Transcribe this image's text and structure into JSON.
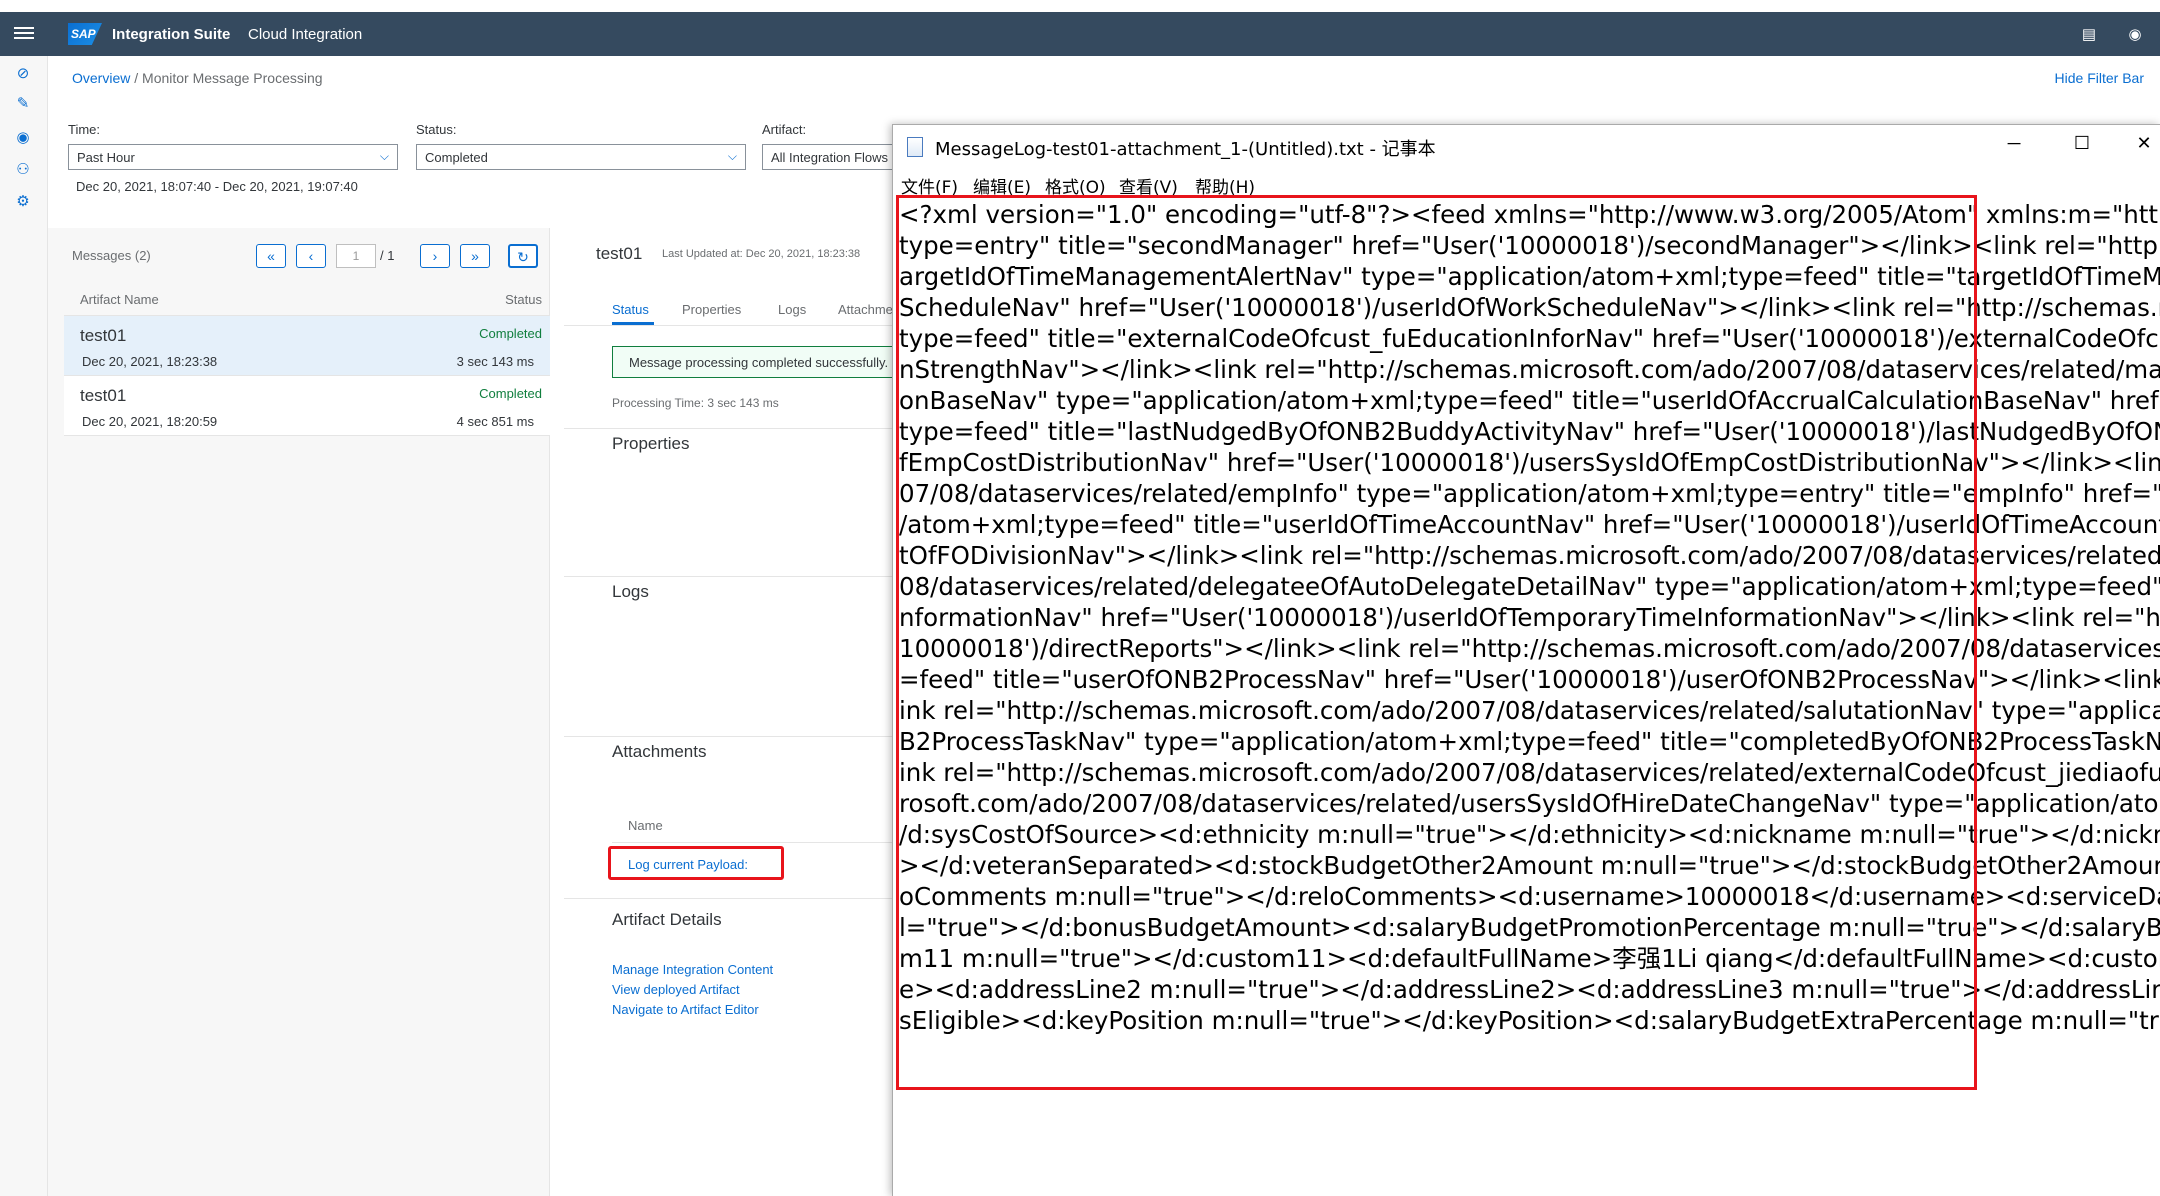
{
  "shell": {
    "logo": "SAP",
    "app_title": "Integration Suite",
    "subtitle": "Cloud Integration"
  },
  "breadcrumb": {
    "overview": "Overview",
    "separator": " / ",
    "current": "Monitor Message Processing"
  },
  "hide_filter_bar": "Hide Filter Bar",
  "filters": {
    "time_label": "Time:",
    "time_value": "Past Hour",
    "status_label": "Status:",
    "status_value": "Completed",
    "artifact_label": "Artifact:",
    "artifact_value": "All Integration Flows",
    "date_range": "Dec 20, 2021, 18:07:40 - Dec 20, 2021, 19:07:40"
  },
  "messages": {
    "count_label": "Messages (2)",
    "page_current": "1",
    "page_total": "/ 1",
    "col_artifact": "Artifact Name",
    "col_status": "Status",
    "rows": [
      {
        "name": "test01",
        "status": "Completed",
        "date": "Dec 20, 2021, 18:23:38",
        "duration": "3 sec 143 ms"
      },
      {
        "name": "test01",
        "status": "Completed",
        "date": "Dec 20, 2021, 18:20:59",
        "duration": "4 sec 851 ms"
      }
    ]
  },
  "detail": {
    "title": "test01",
    "last_updated": "Last Updated at: Dec 20, 2021, 18:23:38",
    "tabs": [
      "Status",
      "Properties",
      "Logs",
      "Attachments"
    ],
    "status_message": "Message processing completed successfully.",
    "processing_time": "Processing Time: 3 sec 143 ms",
    "sections": {
      "properties": "Properties",
      "logs": "Logs",
      "attachments": "Attachments",
      "artifact_details": "Artifact Details"
    },
    "attachments_col_name": "Name",
    "attachment_link": "Log current Payload:",
    "artifact_links": [
      "Manage Integration Content",
      "View deployed Artifact",
      "Navigate to Artifact Editor"
    ]
  },
  "notepad": {
    "title": "MessageLog-test01-attachment_1-(Untitled).txt - 记事本",
    "menu": [
      "文件(F)",
      "编辑(E)",
      "格式(O)",
      "查看(V)",
      "帮助(H)"
    ],
    "content": "<?xml version=\"1.0\" encoding=\"utf-8\"?><feed xmlns=\"http://www.w3.org/2005/Atom\" xmlns:m=\"http://sche\ntype=entry\" title=\"secondManager\" href=\"User('10000018')/secondManager\"></link><link rel=\"http://schema\nargetIdOfTimeManagementAlertNav\" type=\"application/atom+xml;type=feed\" title=\"targetIdOfTimeManager\nScheduleNav\" href=\"User('10000018')/userIdOfWorkScheduleNav\"></link><link rel=\"http://schemas.microso\ntype=feed\" title=\"externalCodeOfcust_fuEducationInforNav\" href=\"User('10000018')/externalCodeOfcust_fuEd\nnStrengthNav\"></link><link rel=\"http://schemas.microsoft.com/ado/2007/08/dataservices/related/manager\"\nonBaseNav\" type=\"application/atom+xml;type=feed\" title=\"userIdOfAccrualCalculationBaseNav\" href=\"User('\ntype=feed\" title=\"lastNudgedByOfONB2BuddyActivityNav\" href=\"User('10000018')/lastNudgedByOfONB2Bu\nfEmpCostDistributionNav\" href=\"User('10000018')/usersSysIdOfEmpCostDistributionNav\"></link><link rel=\"h\n07/08/dataservices/related/empInfo\" type=\"application/atom+xml;type=entry\" title=\"empInfo\" href=\"User('10\n/atom+xml;type=feed\" title=\"userIdOfTimeAccountNav\" href=\"User('10000018')/userIdOfTimeAccountNav\">\ntOfFODivisionNav\"></link><link rel=\"http://schemas.microsoft.com/ado/2007/08/dataservices/related/cust_s\n08/dataservices/related/delegateeOfAutoDelegateDetailNav\" type=\"application/atom+xml;type=feed\" title=\"\nnformationNav\" href=\"User('10000018')/userIdOfTemporaryTimeInformationNav\"></link><link rel=\"http://sc\n10000018')/directReports\"></link><link rel=\"http://schemas.microsoft.com/ado/2007/08/dataservices/relate\n=feed\" title=\"userOfONB2ProcessNav\" href=\"User('10000018')/userOfONB2ProcessNav\"></link><link rel=\"h\nink rel=\"http://schemas.microsoft.com/ado/2007/08/dataservices/related/salutationNav\" type=\"application/at\nB2ProcessTaskNav\" type=\"application/atom+xml;type=feed\" title=\"completedByOfONB2ProcessTaskNav\" hre\nink rel=\"http://schemas.microsoft.com/ado/2007/08/dataservices/related/externalCodeOfcust_jiediaofuNav\" ty\nrosoft.com/ado/2007/08/dataservices/related/usersSysIdOfHireDateChangeNav\" type=\"application/atom+xml\n/d:sysCostOfSource><d:ethnicity m:null=\"true\"></d:ethnicity><d:nickname m:null=\"true\"></d:nickname><d\n></d:veteranSeparated><d:stockBudgetOther2Amount m:null=\"true\"></d:stockBudgetOther2Amount><d:fi\noComments m:null=\"true\"></d:reloComments><d:username>10000018</d:username><d:serviceDate m:nul\nl=\"true\"></d:bonusBudgetAmount><d:salaryBudgetPromotionPercentage m:null=\"true\"></d:salaryBudgetP\nm11 m:null=\"true\"></d:custom11><d:defaultFullName>李强1Li qiang</d:defaultFullName><d:custom10 m:n\ne><d:addressLine2 m:null=\"true\"></d:addressLine2><d:addressLine3 m:null=\"true\"></d:addressLine3><d:m\nsEligible><d:keyPosition m:null=\"true\"></d:keyPosition><d:salaryBudgetExtraPercentage m:null=\"true\"></d"
  }
}
